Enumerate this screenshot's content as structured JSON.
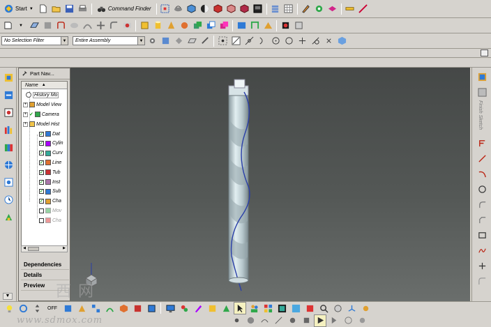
{
  "toolbar1": {
    "start_label": "Start",
    "command_finder_label": "Command Finder"
  },
  "selbar": {
    "filter_value": "No Selection Filter",
    "scope_value": "Entire Assembly"
  },
  "navigator": {
    "title": "Part Nav...",
    "column_header": "Name",
    "items": [
      {
        "label": "History Mo",
        "checked": false,
        "dim": false
      },
      {
        "label": "Model View",
        "checked": false,
        "dim": false
      },
      {
        "label": "Camera",
        "checked": true,
        "dim": false
      },
      {
        "label": "Model Hist",
        "checked": false,
        "dim": false
      },
      {
        "label": "Dat",
        "checked": true,
        "dim": false
      },
      {
        "label": "Cylin",
        "checked": true,
        "dim": false
      },
      {
        "label": "Curv",
        "checked": true,
        "dim": false
      },
      {
        "label": "Line",
        "checked": true,
        "dim": false
      },
      {
        "label": "Tub",
        "checked": true,
        "dim": false
      },
      {
        "label": "Inst",
        "checked": true,
        "dim": false
      },
      {
        "label": "Sub",
        "checked": true,
        "dim": false
      },
      {
        "label": "Cha",
        "checked": true,
        "dim": false
      },
      {
        "label": "Mov",
        "checked": false,
        "dim": true
      },
      {
        "label": "Cha",
        "checked": false,
        "dim": true
      }
    ],
    "sections": {
      "dependencies": "Dependencies",
      "details": "Details",
      "preview": "Preview"
    }
  },
  "rightbar": {
    "vertical_text": "Finish Sketch"
  },
  "bottombar": {
    "off_label": "OFF"
  },
  "watermark": {
    "chars": "西网",
    "url": "www.sdmox.com"
  },
  "colors": {
    "viewport_top": "#454847",
    "viewport_bottom": "#6a6e6c",
    "drill_body": "#c7d6da",
    "helix": "#2a3fa8"
  }
}
